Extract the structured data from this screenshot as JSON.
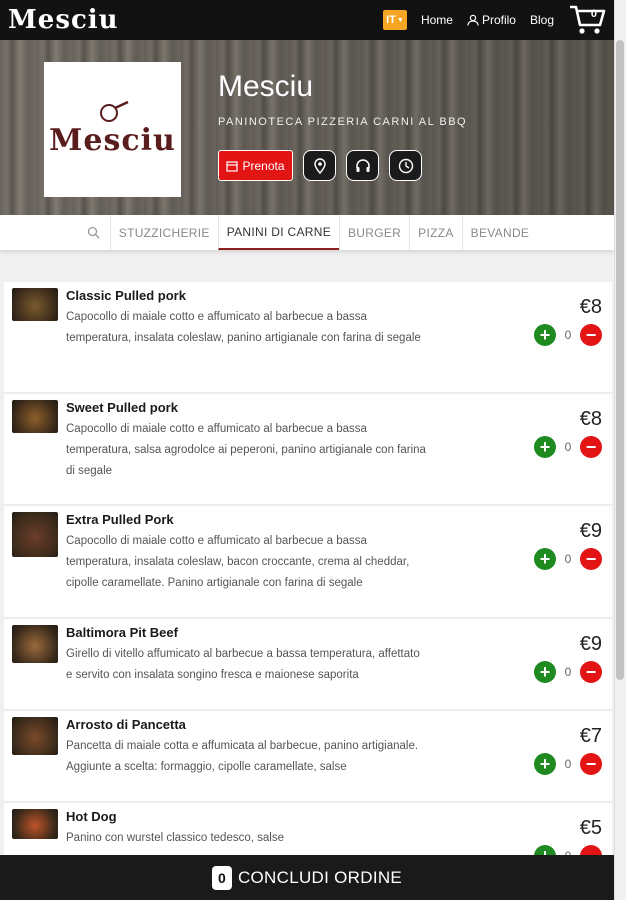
{
  "header": {
    "brand": "Mesciu",
    "lang": "IT",
    "nav": [
      {
        "label": "Home"
      },
      {
        "label": "Profilo"
      },
      {
        "label": "Blog"
      }
    ],
    "cart_count": "0"
  },
  "hero": {
    "logo_text": "Mesciu",
    "name": "Mesciu",
    "subtitle": "PANINOTECA PIZZERIA CARNI AL BBQ",
    "prenota_label": "Prenota"
  },
  "tabs": [
    {
      "label": "STUZZICHERIE"
    },
    {
      "label": "PANINI DI CARNE"
    },
    {
      "label": "BURGER"
    },
    {
      "label": "PIZZA"
    },
    {
      "label": "BEVANDE"
    }
  ],
  "items": [
    {
      "name": "Classic Pulled pork",
      "desc": "Capocollo di maiale cotto e affumicato al barbecue a bassa temperatura, insalata coleslaw, panino artigianale con farina di segale",
      "price": "€8",
      "qty": "0",
      "color": "#7a5a2e"
    },
    {
      "name": "Sweet Pulled pork",
      "desc": "Capocollo di maiale cotto e affumicato al barbecue a bassa temperatura, salsa agrodolce ai peperoni, panino artigianale con farina di segale",
      "price": "€8",
      "qty": "0",
      "color": "#8d5f2a"
    },
    {
      "name": "Extra Pulled Pork",
      "desc": "Capocollo di maiale cotto e affumicato al barbecue a bassa temperatura, insalata coleslaw, bacon croccante, crema al cheddar, cipolle caramellate. Panino artigianale con farina di segale",
      "price": "€9",
      "qty": "0",
      "color": "#6b3d2a"
    },
    {
      "name": "Baltimora Pit Beef",
      "desc": "Girello di vitello affumicato al barbecue a bassa temperatura, affettato e servito con insalata songino fresca e maionese saporita",
      "price": "€9",
      "qty": "0",
      "color": "#9a6b3e"
    },
    {
      "name": "Arrosto di Pancetta",
      "desc": "Pancetta di maiale cotta e affumicata al barbecue, panino artigianale. Aggiunte a scelta: formaggio, cipolle caramellate, salse",
      "price": "€7",
      "qty": "0",
      "color": "#7a4a2b"
    },
    {
      "name": "Hot Dog",
      "desc": "Panino con wurstel classico tedesco, salse",
      "price": "€5",
      "qty": "0",
      "color": "#c0532a"
    }
  ],
  "order_bar": {
    "count": "0",
    "label": "CONCLUDI ORDINE"
  },
  "colors": {
    "accent_red": "#e31414",
    "plus_green": "#1f8a1f",
    "topbar": "#121212",
    "lang_badge": "#f5a623"
  }
}
